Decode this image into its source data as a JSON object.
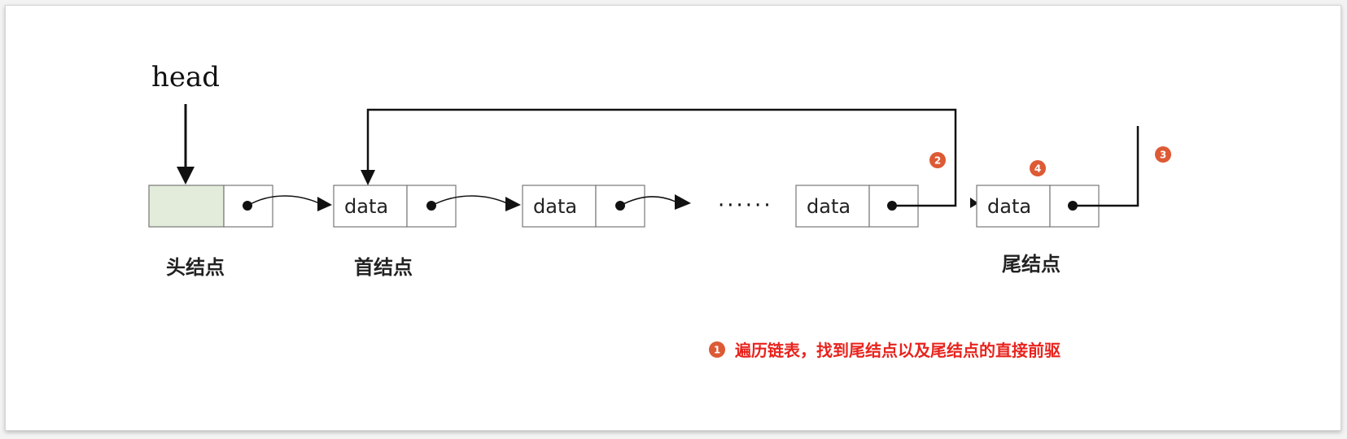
{
  "pointer_label": "head",
  "ellipsis": "······",
  "node_text": "data",
  "labels": {
    "head_node": "头结点",
    "first_node": "首结点",
    "tail_node": "尾结点"
  },
  "badges": [
    "1",
    "2",
    "3",
    "4"
  ],
  "caption": "遍历链表，找到尾结点以及尾结点的直接前驱",
  "colors": {
    "head_cell_fill": "#e3ecdb",
    "badge": "#dd5a35",
    "caption": "#e8231d",
    "line": "#111111"
  }
}
